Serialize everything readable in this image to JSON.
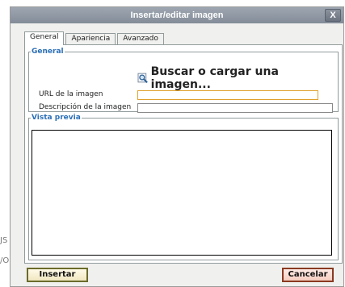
{
  "background_fragments": [
    "JS",
    "/O"
  ],
  "dialog": {
    "title": "Insertar/editar imagen",
    "close_label": "X"
  },
  "tabs": [
    {
      "label": "General",
      "active": true
    },
    {
      "label": "Apariencia",
      "active": false
    },
    {
      "label": "Avanzado",
      "active": false
    }
  ],
  "general": {
    "legend": "General",
    "browse_label": "Buscar o cargar una imagen...",
    "browse_icon": "magnifier-icon",
    "url_label": "URL de la imagen",
    "url_value": "",
    "description_label": "Descripción de la imagen",
    "description_value": ""
  },
  "preview": {
    "legend": "Vista previa"
  },
  "buttons": {
    "insert": "Insertar",
    "cancel": "Cancelar"
  },
  "colors": {
    "legend": "#2b6fb6",
    "focus_border": "#e0a02b",
    "title_bar": "#8f98a4"
  }
}
